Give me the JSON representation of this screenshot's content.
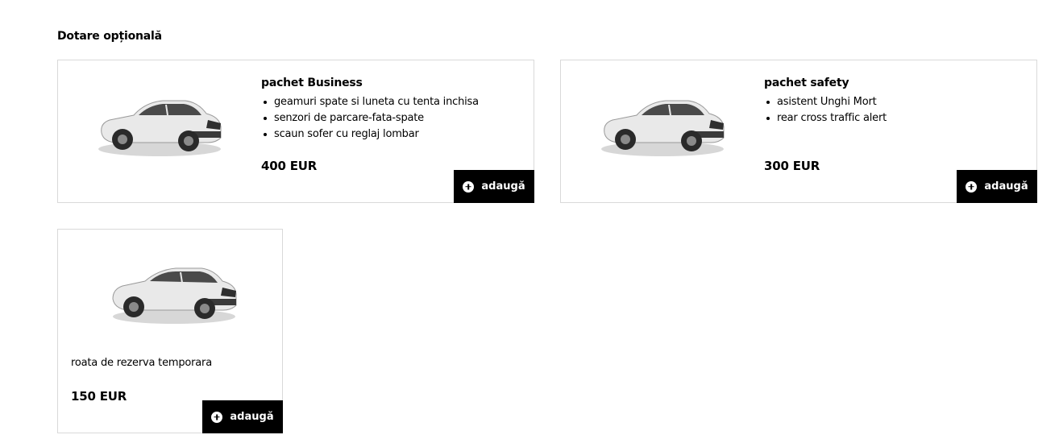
{
  "section": {
    "title": "Dotare opțională"
  },
  "options": [
    {
      "title": "pachet Business",
      "features": [
        "geamuri spate si luneta cu tenta inchisa",
        "senzori de parcare-fata-spate",
        "scaun sofer cu reglaj lombar"
      ],
      "price": "400 EUR",
      "add_label": "adaugă",
      "image_icon": "car-image-icon"
    },
    {
      "title": "pachet safety",
      "features": [
        "asistent Unghi Mort",
        "rear cross traffic alert"
      ],
      "price": "300 EUR",
      "add_label": "adaugă",
      "image_icon": "car-image-icon"
    },
    {
      "description": "roata de rezerva temporara",
      "price": "150 EUR",
      "add_label": "adaugă",
      "image_icon": "car-image-icon"
    }
  ],
  "colors": {
    "button_bg": "#000000",
    "card_border": "#d9d9d9",
    "text": "#000000"
  }
}
